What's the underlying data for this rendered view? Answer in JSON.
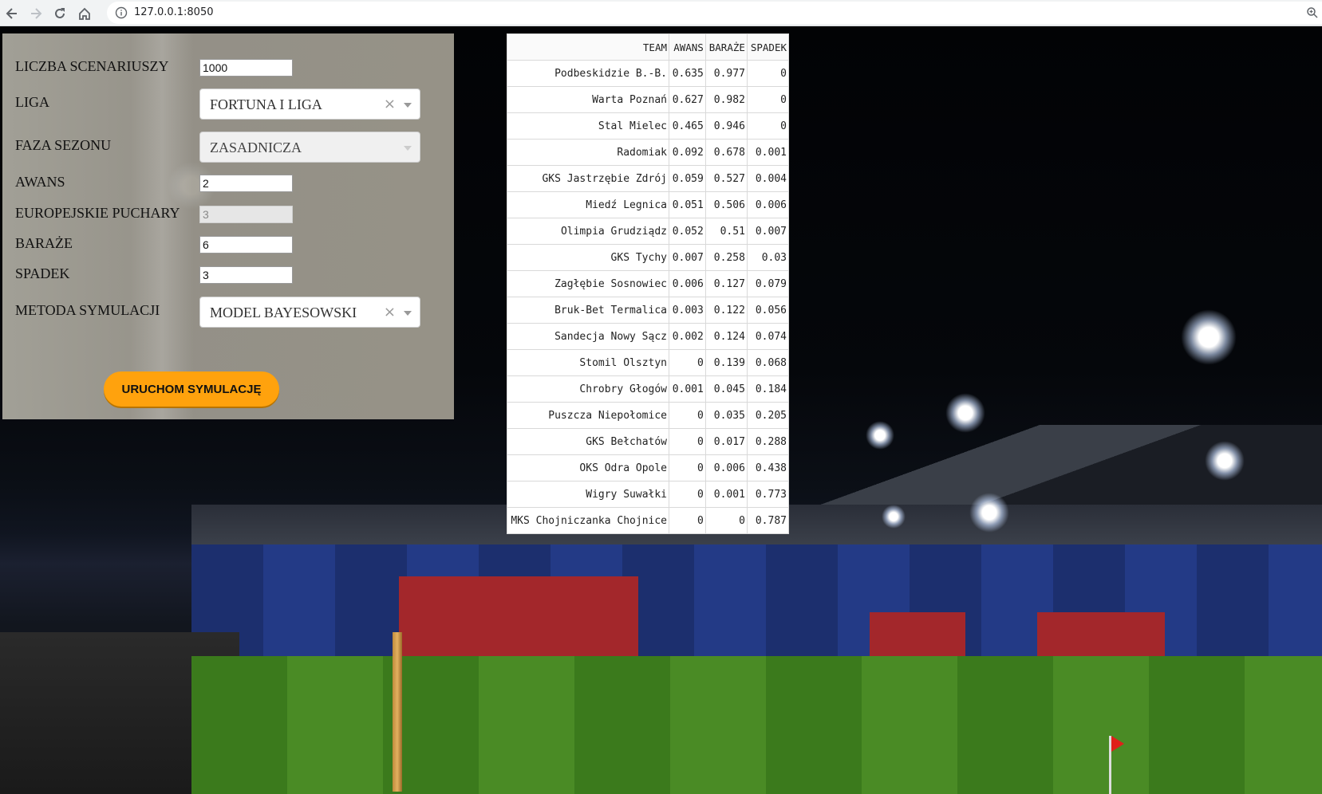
{
  "browser": {
    "url": "127.0.0.1:8050"
  },
  "form": {
    "scenarios": {
      "label": "LICZBA SCENARIUSZY",
      "value": "1000"
    },
    "league": {
      "label": "LIGA",
      "value": "FORTUNA I LIGA"
    },
    "phase": {
      "label": "FAZA SEZONU",
      "value": "ZASADNICZA"
    },
    "promotion": {
      "label": "AWANS",
      "value": "2"
    },
    "european": {
      "label": "EUROPEJSKIE PUCHARY",
      "value": "3"
    },
    "playoffs": {
      "label": "BARAŻE",
      "value": "6"
    },
    "relegation": {
      "label": "SPADEK",
      "value": "3"
    },
    "method": {
      "label": "METODA SYMULACJI",
      "value": "MODEL BAYESOWSKI"
    },
    "run_button": "URUCHOM SYMULACJĘ"
  },
  "table": {
    "headers": [
      "TEAM",
      "AWANS",
      "BARAŻE",
      "SPADEK"
    ],
    "rows": [
      [
        "Podbeskidzie B.-B.",
        "0.635",
        "0.977",
        "0"
      ],
      [
        "Warta Poznań",
        "0.627",
        "0.982",
        "0"
      ],
      [
        "Stal Mielec",
        "0.465",
        "0.946",
        "0"
      ],
      [
        "Radomiak",
        "0.092",
        "0.678",
        "0.001"
      ],
      [
        "GKS Jastrzębie Zdrój",
        "0.059",
        "0.527",
        "0.004"
      ],
      [
        "Miedź Legnica",
        "0.051",
        "0.506",
        "0.006"
      ],
      [
        "Olimpia Grudziądz",
        "0.052",
        "0.51",
        "0.007"
      ],
      [
        "GKS Tychy",
        "0.007",
        "0.258",
        "0.03"
      ],
      [
        "Zagłębie Sosnowiec",
        "0.006",
        "0.127",
        "0.079"
      ],
      [
        "Bruk-Bet Termalica",
        "0.003",
        "0.122",
        "0.056"
      ],
      [
        "Sandecja Nowy Sącz",
        "0.002",
        "0.124",
        "0.074"
      ],
      [
        "Stomil Olsztyn",
        "0",
        "0.139",
        "0.068"
      ],
      [
        "Chrobry Głogów",
        "0.001",
        "0.045",
        "0.184"
      ],
      [
        "Puszcza Niepołomice",
        "0",
        "0.035",
        "0.205"
      ],
      [
        "GKS Bełchatów",
        "0",
        "0.017",
        "0.288"
      ],
      [
        "OKS Odra Opole",
        "0",
        "0.006",
        "0.438"
      ],
      [
        "Wigry Suwałki",
        "0",
        "0.001",
        "0.773"
      ],
      [
        "MKS Chojniczanka Chojnice",
        "0",
        "0",
        "0.787"
      ]
    ]
  },
  "colors": {
    "button": "#ffa20d",
    "panel": "#a09c92"
  }
}
